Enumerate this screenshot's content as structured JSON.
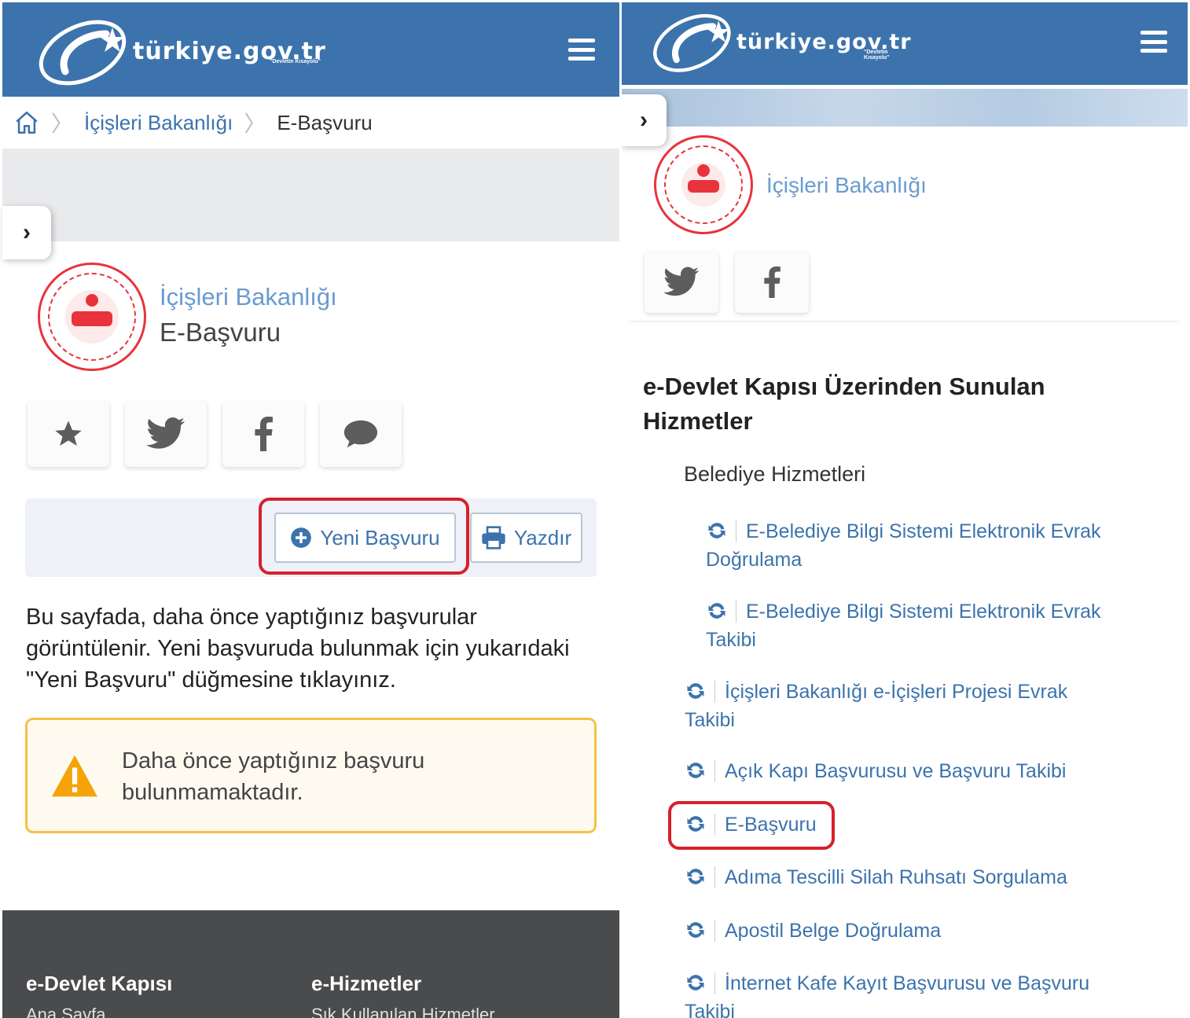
{
  "brand": {
    "name": "türkiye.gov.tr",
    "tagline": "\"Devletin Kısayolu\""
  },
  "left": {
    "breadcrumb": {
      "items": [
        "İçişleri Bakanlığı",
        "E-Başvuru"
      ]
    },
    "org": {
      "name": "İçişleri Bakanlığı",
      "page": "E-Başvuru"
    },
    "actions": {
      "new_label": "Yeni Başvuru",
      "print_label": "Yazdır"
    },
    "info": "Bu sayfada, daha önce yaptığınız başvurular görüntülenir. Yeni başvuruda bulunmak için yukarıdaki \"Yeni Başvuru\" düğmesine tıklayınız.",
    "alert": "Daha önce yaptığınız başvuru bulunmamaktadır.",
    "footer": {
      "col1_title": "e-Devlet Kapısı",
      "col1_link": "Ana Sayfa",
      "col2_title": "e-Hizmetler",
      "col2_link": "Sık Kullanılan Hizmetler"
    }
  },
  "right": {
    "org": {
      "name": "İçişleri Bakanlığı"
    },
    "section_title": "e-Devlet Kapısı Üzerinden Sunulan Hizmetler",
    "category": "Belediye Hizmetleri",
    "services": [
      "E-Belediye Bilgi Sistemi Elektronik Evrak Doğrulama",
      "E-Belediye Bilgi Sistemi Elektronik Evrak Takibi",
      "İçişleri Bakanlığı e-İçişleri Projesi Evrak Takibi",
      "Açık Kapı Başvurusu ve Başvuru Takibi",
      "E-Başvuru",
      "Adıma Tescilli Silah Ruhsatı Sorgulama",
      "Apostil Belge Doğrulama",
      "İnternet Kafe Kayıt Başvurusu ve Başvuru Takibi"
    ]
  },
  "colors": {
    "header": "#3c73ad",
    "highlight": "#d8202b",
    "alert_border": "#f5c242",
    "link": "#3c73ad"
  },
  "icons": [
    "home-icon",
    "chevron-right-icon",
    "star-icon",
    "twitter-icon",
    "facebook-icon",
    "comment-icon",
    "plus-circle-icon",
    "print-icon",
    "warning-icon",
    "refresh-icon"
  ]
}
